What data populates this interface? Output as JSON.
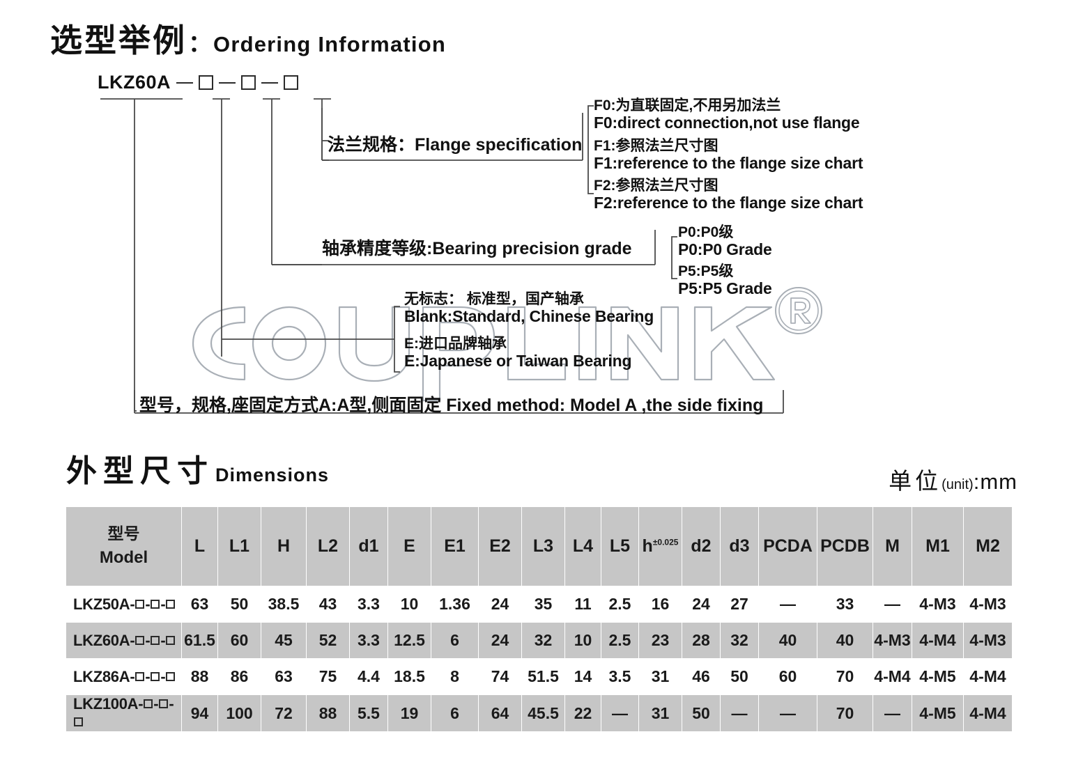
{
  "ordering": {
    "heading_cn": "选型举例",
    "heading_colon": "：",
    "heading_en": "Ordering Information",
    "model_code": "LKZ60A",
    "separator": "—",
    "box_count": 3,
    "flange": {
      "label_cn": "法兰规格：",
      "label_en": "Flange specification",
      "options": [
        {
          "cn": "F0:为直联固定,不用另加法兰",
          "en": "F0:direct connection,not use flange"
        },
        {
          "cn": "F1:参照法兰尺寸图",
          "en": "F1:reference to the flange size chart"
        },
        {
          "cn": "F2:参照法兰尺寸图",
          "en": "F2:reference to the flange size chart"
        }
      ]
    },
    "precision": {
      "label_cn": "轴承精度等级:",
      "label_en": "Bearing precision grade",
      "options": [
        {
          "cn": "P0:P0级",
          "en": "P0:P0 Grade"
        },
        {
          "cn": "P5:P5级",
          "en": "P5:P5 Grade"
        }
      ]
    },
    "bearing": {
      "options": [
        {
          "cn": "无标志： 标准型，国产轴承",
          "en": "Blank:Standard, Chinese Bearing"
        },
        {
          "cn": "E:进口品牌轴承",
          "en": "E:Japanese or Taiwan Bearing"
        }
      ]
    },
    "base": {
      "text": "型号，规格,座固定方式A:A型,侧面固定 Fixed method: Model A ,the side fixing"
    }
  },
  "dimensions": {
    "heading_cn": "外型尺寸",
    "heading_en": "Dimensions",
    "unit_cn": "单位",
    "unit_paren": "(unit)",
    "unit_colon": ":",
    "unit_value": "mm",
    "table": {
      "model_header_cn": "型号",
      "model_header_en": "Model",
      "columns": [
        "L",
        "L1",
        "H",
        "L2",
        "d1",
        "E",
        "E1",
        "E2",
        "L3",
        "L4",
        "L5",
        "h",
        "d2",
        "d3",
        "PCDA",
        "PCDB",
        "M",
        "M1",
        "M2"
      ],
      "h_tolerance": "±0.025",
      "rows": [
        {
          "model_prefix": "LKZ50A-",
          "values": [
            "63",
            "50",
            "38.5",
            "43",
            "3.3",
            "10",
            "1.36",
            "24",
            "35",
            "11",
            "2.5",
            "16",
            "24",
            "27",
            "—",
            "33",
            "—",
            "4-M3",
            "4-M3"
          ]
        },
        {
          "model_prefix": "LKZ60A-",
          "values": [
            "61.5",
            "60",
            "45",
            "52",
            "3.3",
            "12.5",
            "6",
            "24",
            "32",
            "10",
            "2.5",
            "23",
            "28",
            "32",
            "40",
            "40",
            "4-M3",
            "4-M4",
            "4-M3"
          ]
        },
        {
          "model_prefix": "LKZ86A-",
          "values": [
            "88",
            "86",
            "63",
            "75",
            "4.4",
            "18.5",
            "8",
            "74",
            "51.5",
            "14",
            "3.5",
            "31",
            "46",
            "50",
            "60",
            "70",
            "4-M4",
            "4-M5",
            "4-M4"
          ]
        },
        {
          "model_prefix": "LKZ100A-",
          "values": [
            "94",
            "100",
            "72",
            "88",
            "5.5",
            "19",
            "6",
            "64",
            "45.5",
            "22",
            "—",
            "31",
            "50",
            "—",
            "—",
            "70",
            "—",
            "4-M5",
            "4-M4"
          ]
        }
      ]
    }
  },
  "watermark": {
    "text": "COUPLINK",
    "registered_mark": "®",
    "color": "#9aa0a6"
  },
  "colors": {
    "header_gray": "#c6c6c6",
    "row_gray": "#c6c6c6",
    "row_white": "#ffffff",
    "text": "#1a1a1a",
    "line": "#4a4a4a"
  }
}
